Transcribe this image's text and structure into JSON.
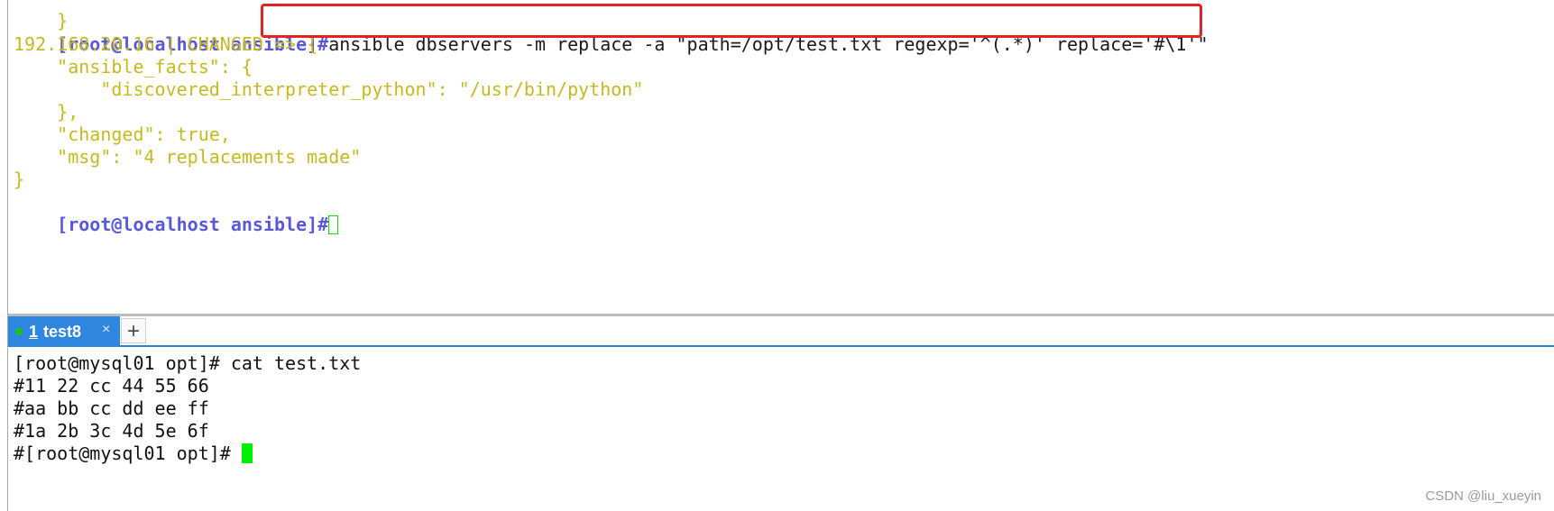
{
  "top_terminal": {
    "partial_brace": "}",
    "command_prompt": "[root@localhost ansible]",
    "command_hash": "#",
    "command_text": "ansible dbservers -m replace -a \"path=/opt/test.txt regexp='^(.*)' replace='#\\1'\"",
    "output_lines": [
      "192.168.20.16 | CHANGED => {",
      "    \"ansible_facts\": {",
      "        \"discovered_interpreter_python\": \"/usr/bin/python\"",
      "    },",
      "    \"changed\": true,",
      "    \"msg\": \"4 replacements made\"",
      "}"
    ],
    "final_prompt": "[root@localhost ansible]",
    "final_hash": "#"
  },
  "tab_bar": {
    "tab_number": "1",
    "tab_label": "test8",
    "close_glyph": "×",
    "add_glyph": "+",
    "status_color": "#17c617"
  },
  "bottom_terminal": {
    "lines": [
      "[root@mysql01 opt]# cat test.txt",
      "#11 22 cc 44 55 66",
      "#aa bb cc dd ee ff",
      "#1a 2b 3c 4d 5e 6f",
      "#[root@mysql01 opt]# "
    ]
  },
  "watermark": "CSDN @liu_xueyin",
  "colors": {
    "prompt": "#5858d8",
    "output": "#c5b922",
    "highlight_box": "#e02424",
    "cursor": "#00ee00",
    "tab_active": "#2f86df"
  }
}
